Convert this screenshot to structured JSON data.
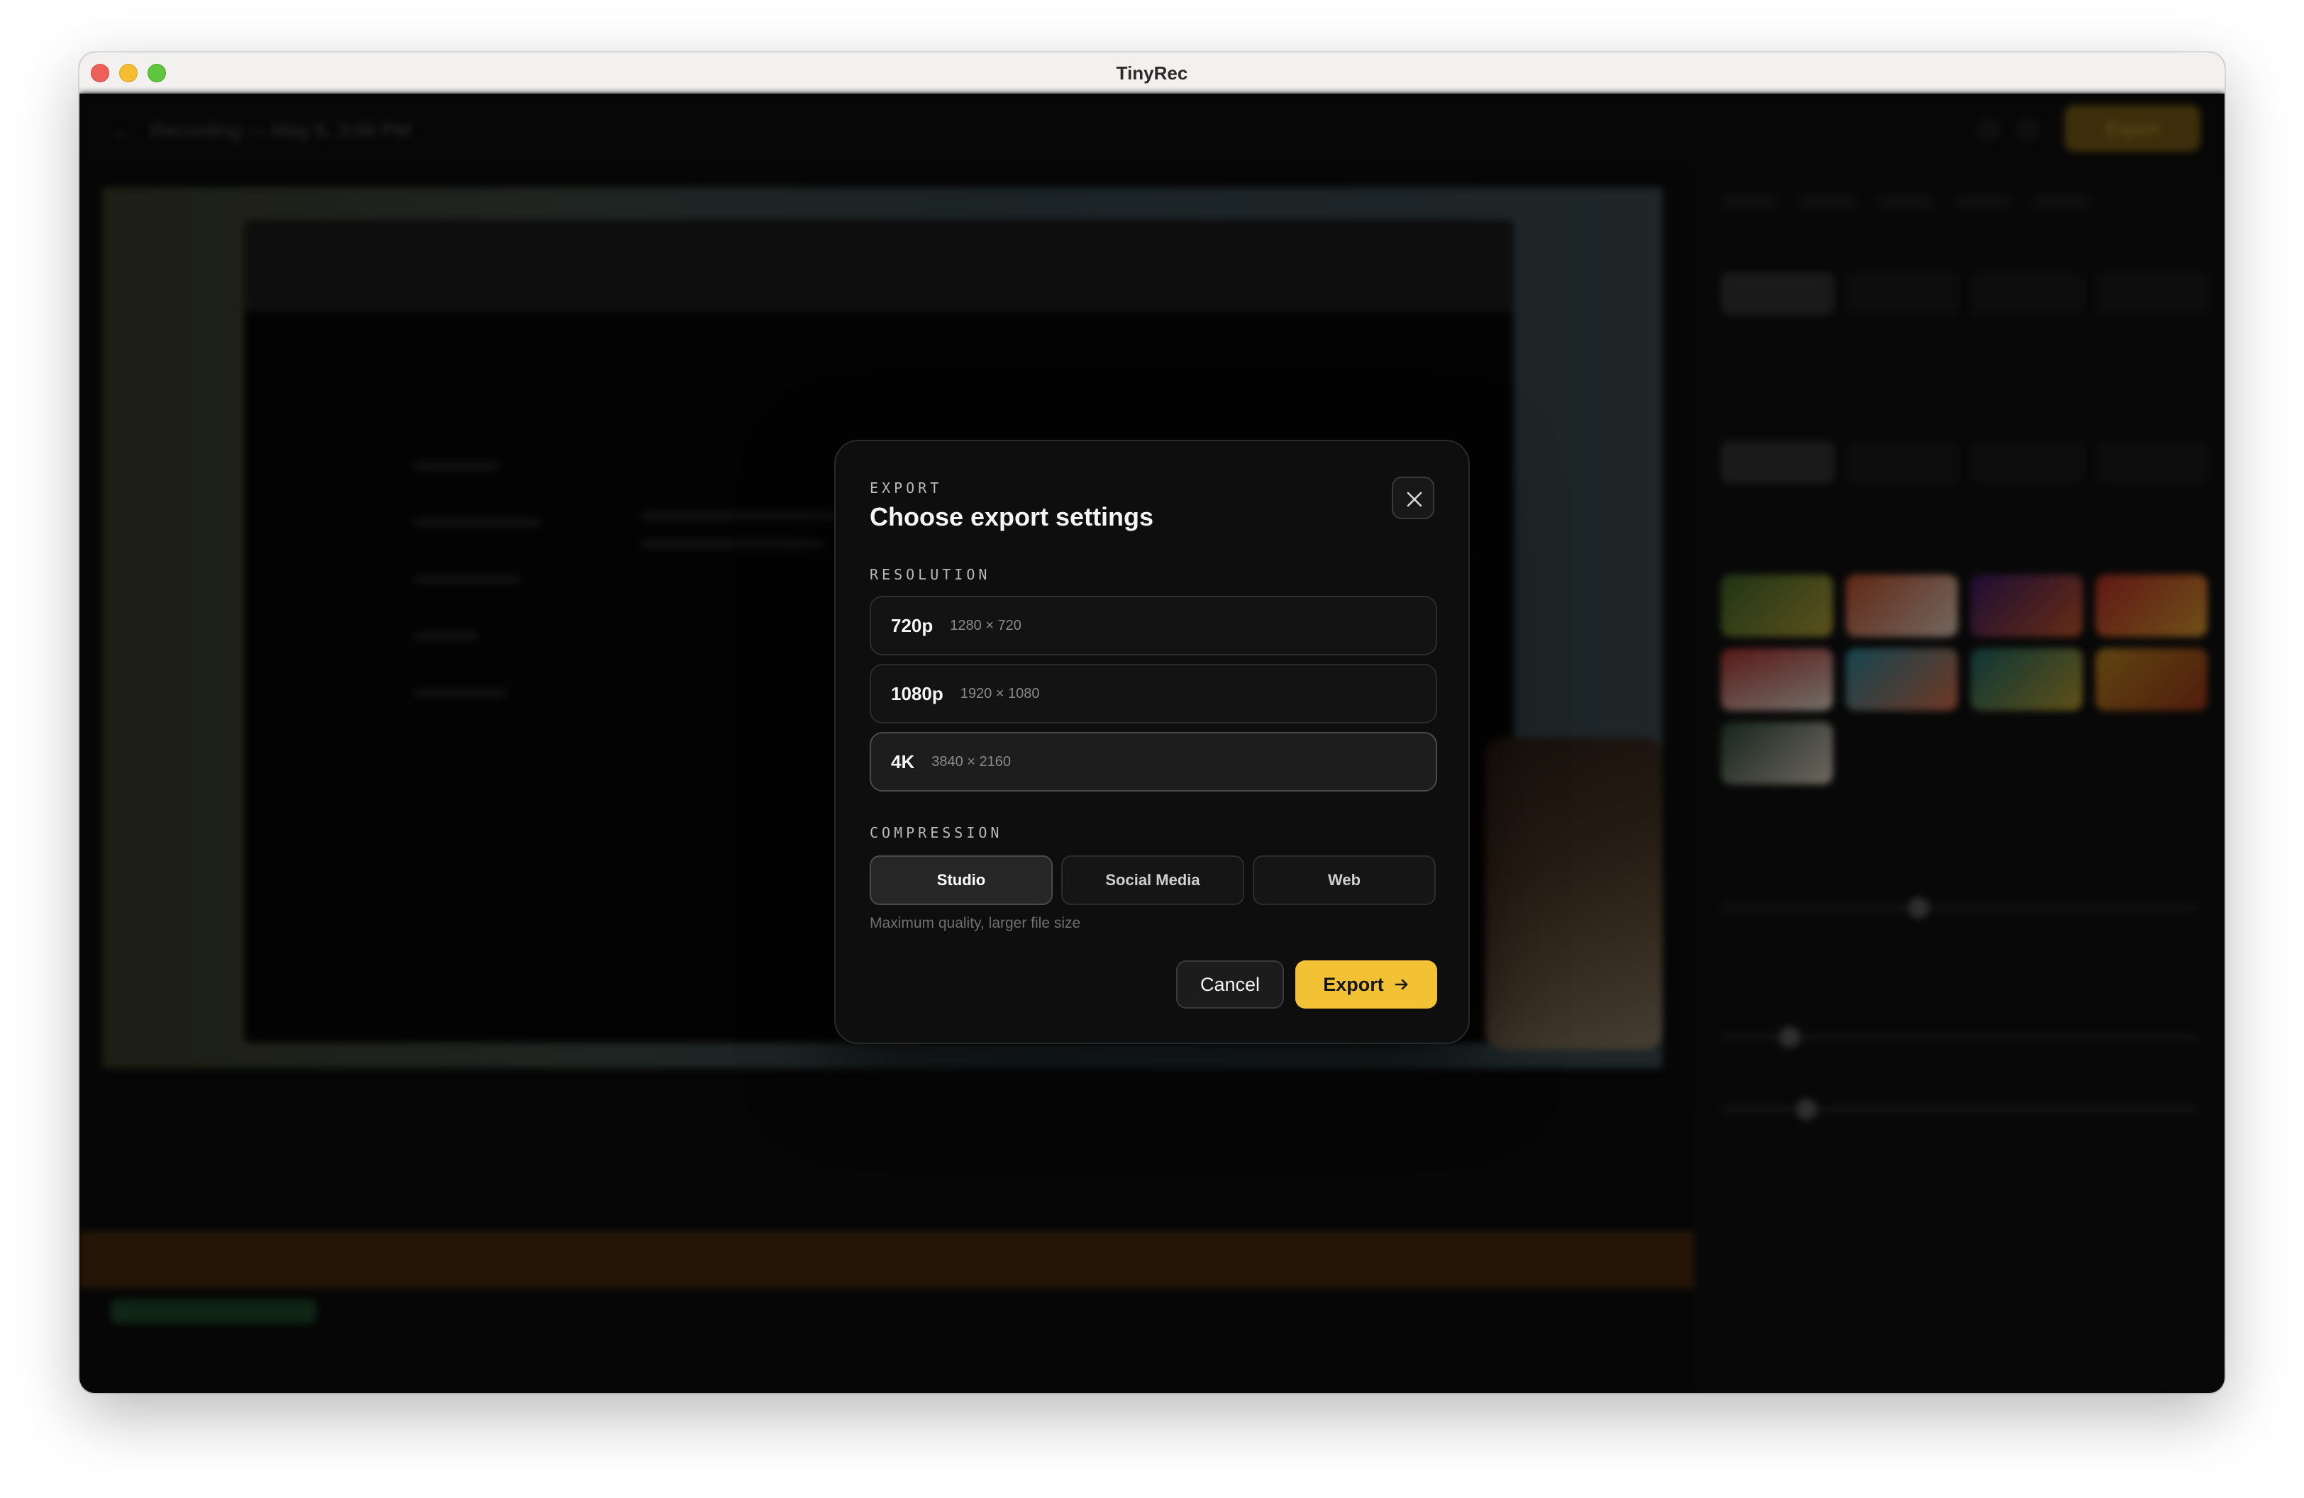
{
  "window": {
    "title": "TinyRec"
  },
  "background": {
    "recording_title": "Recording — May 6, 3:56 PM",
    "export_button": "Export"
  },
  "modal": {
    "eyebrow": "EXPORT",
    "title": "Choose export settings",
    "close_icon": "close-icon",
    "resolution_label": "RESOLUTION",
    "resolutions": [
      {
        "name": "720p",
        "dims": "1280 × 720",
        "selected": false
      },
      {
        "name": "1080p",
        "dims": "1920 × 1080",
        "selected": false
      },
      {
        "name": "4K",
        "dims": "3840 × 2160",
        "selected": true
      }
    ],
    "compression_label": "COMPRESSION",
    "compression_options": [
      {
        "label": "Studio",
        "selected": true
      },
      {
        "label": "Social Media",
        "selected": false
      },
      {
        "label": "Web",
        "selected": false
      }
    ],
    "compression_hint": "Maximum quality, larger file size",
    "cancel_label": "Cancel",
    "export_label": "Export",
    "export_icon": "arrow-right-icon"
  },
  "colors": {
    "accent": "#f3c234",
    "modal_bg": "#0e0e0e",
    "overlay": "#000000"
  }
}
